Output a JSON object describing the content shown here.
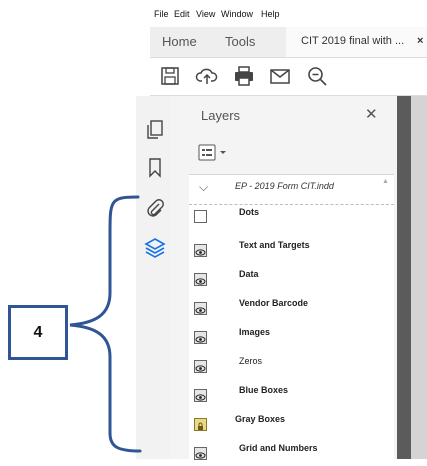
{
  "menu": [
    "File",
    "Edit",
    "View",
    "Window",
    "Help"
  ],
  "tabs": {
    "home": "Home",
    "tools": "Tools",
    "document": "CIT 2019 final with ...",
    "close": "×"
  },
  "toolbar": [
    "save-icon",
    "upload-icon",
    "print-icon",
    "mail-icon",
    "zoom-icon"
  ],
  "rail": [
    "pages-icon",
    "bookmark-icon",
    "attachment-icon",
    "layers-icon"
  ],
  "layers_panel": {
    "title": "Layers",
    "close": "✕",
    "root": {
      "expander": "⌵",
      "label": "EP - 2019 Form CIT.indd"
    },
    "layers": [
      {
        "name": "Dots",
        "state": "hidden"
      },
      {
        "name": "Text and Targets",
        "state": "visible"
      },
      {
        "name": "Data",
        "state": "visible"
      },
      {
        "name": "Vendor Barcode",
        "state": "visible"
      },
      {
        "name": "Images",
        "state": "visible"
      },
      {
        "name": "Zeros",
        "state": "visible"
      },
      {
        "name": "Blue Boxes",
        "state": "visible"
      },
      {
        "name": "Gray Boxes",
        "state": "locked"
      },
      {
        "name": "Grid and Numbers",
        "state": "visible"
      }
    ]
  },
  "annotation": {
    "label": "4",
    "color": "#2f5597"
  },
  "colors": {
    "accent": "#1473e6",
    "annotation": "#2f5597"
  }
}
